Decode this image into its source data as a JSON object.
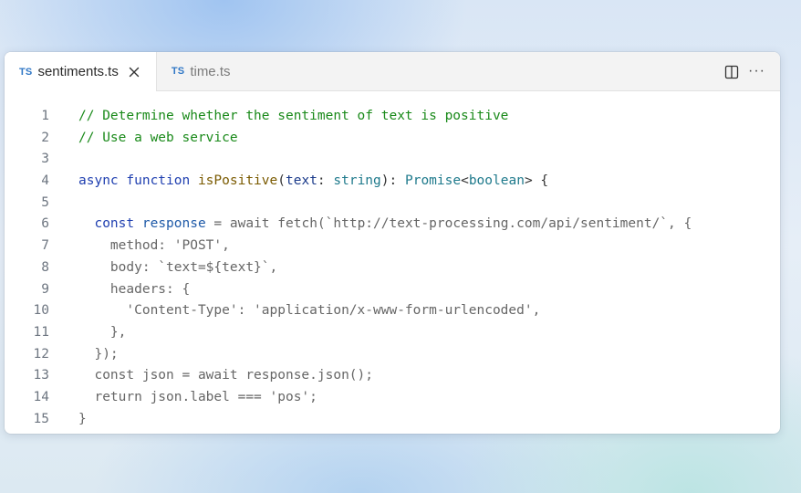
{
  "tabs": [
    {
      "badge": "TS",
      "label": "sentiments.ts",
      "active": true
    },
    {
      "badge": "TS",
      "label": "time.ts",
      "active": false
    }
  ],
  "actions": {
    "more_label": "···"
  },
  "code": {
    "lines": [
      {
        "n": "1",
        "tokens": [
          {
            "t": "// Determine whether the sentiment of text is positive",
            "c": "comment"
          }
        ]
      },
      {
        "n": "2",
        "tokens": [
          {
            "t": "// Use a web service",
            "c": "comment"
          }
        ]
      },
      {
        "n": "3",
        "tokens": []
      },
      {
        "n": "4",
        "tokens": [
          {
            "t": "async function ",
            "c": "keyword"
          },
          {
            "t": "isPositive",
            "c": "fn"
          },
          {
            "t": "(",
            "c": "plain"
          },
          {
            "t": "text",
            "c": "param"
          },
          {
            "t": ": ",
            "c": "plain"
          },
          {
            "t": "string",
            "c": "type"
          },
          {
            "t": "): ",
            "c": "plain"
          },
          {
            "t": "Promise",
            "c": "type"
          },
          {
            "t": "<",
            "c": "plain"
          },
          {
            "t": "boolean",
            "c": "type"
          },
          {
            "t": "> {",
            "c": "plain"
          }
        ]
      },
      {
        "n": "5",
        "tokens": []
      },
      {
        "n": "6",
        "tokens": [
          {
            "t": "  ",
            "c": "plain"
          },
          {
            "t": "const ",
            "c": "keyword"
          },
          {
            "t": "response",
            "c": "var"
          },
          {
            "t": " = await fetch(`http://text-processing.com/api/sentiment/`, {",
            "c": "muted"
          }
        ]
      },
      {
        "n": "7",
        "tokens": [
          {
            "t": "    method: 'POST',",
            "c": "muted"
          }
        ]
      },
      {
        "n": "8",
        "tokens": [
          {
            "t": "    body: `text=${text}`,",
            "c": "muted"
          }
        ]
      },
      {
        "n": "9",
        "tokens": [
          {
            "t": "    headers: {",
            "c": "muted"
          }
        ]
      },
      {
        "n": "10",
        "tokens": [
          {
            "t": "      'Content-Type': 'application/x-www-form-urlencoded',",
            "c": "muted"
          }
        ]
      },
      {
        "n": "11",
        "tokens": [
          {
            "t": "    },",
            "c": "muted"
          }
        ]
      },
      {
        "n": "12",
        "tokens": [
          {
            "t": "  });",
            "c": "muted"
          }
        ]
      },
      {
        "n": "13",
        "tokens": [
          {
            "t": "  const json = await response.json();",
            "c": "muted"
          }
        ]
      },
      {
        "n": "14",
        "tokens": [
          {
            "t": "  return json.label === 'pos';",
            "c": "muted"
          }
        ]
      },
      {
        "n": "15",
        "tokens": [
          {
            "t": "}",
            "c": "muted"
          }
        ]
      }
    ]
  }
}
